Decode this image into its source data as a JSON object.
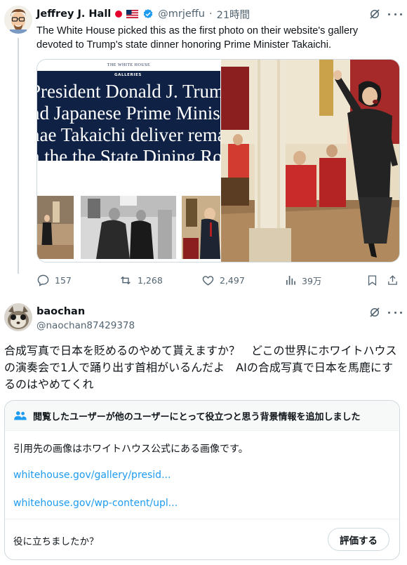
{
  "post1": {
    "author_name": "Jeffrey J. Hall",
    "handle": "@mrjeffu",
    "dot": "·",
    "time": "21時間",
    "text": "The White House picked this as the first photo on their website's gallery devoted to Trump's state dinner honoring Prime Minister Takaichi.",
    "media": {
      "site_header": "THE WHITE HOUSE",
      "section_label": "GALLERIES",
      "headline_lines": [
        "President Donald J. Trump",
        "nd Japanese Prime Ministe",
        "nae Takaichi deliver remar",
        "n the the State Dining Roo"
      ]
    },
    "stats": {
      "replies": "157",
      "reposts": "1,268",
      "likes": "2,497",
      "views": "39万"
    }
  },
  "post2": {
    "author_name": "baochan",
    "handle": "@naochan87429378",
    "text": "合成写真で日本を貶めるのやめて貰えますか？　どこの世界にホワイトハウスの演奏会で1人で踊り出す首相がいるんだよ　AIの合成写真で日本を馬鹿にするのはやめてくれ"
  },
  "community_note": {
    "header": "閲覧したユーザーが他のユーザーにとって役立つと思う背景情報を追加しました",
    "body": "引用先の画像はホワイトハウス公式にある画像です。",
    "links": [
      "whitehouse.gov/gallery/presid...",
      "whitehouse.gov/wp-content/upl..."
    ],
    "question": "役に立ちましたか？",
    "rate_label": "評価する"
  },
  "colors": {
    "accent": "#1d9bf0",
    "muted": "#536471",
    "border": "#cfd9de",
    "gallery_navy": "#0f2144"
  }
}
